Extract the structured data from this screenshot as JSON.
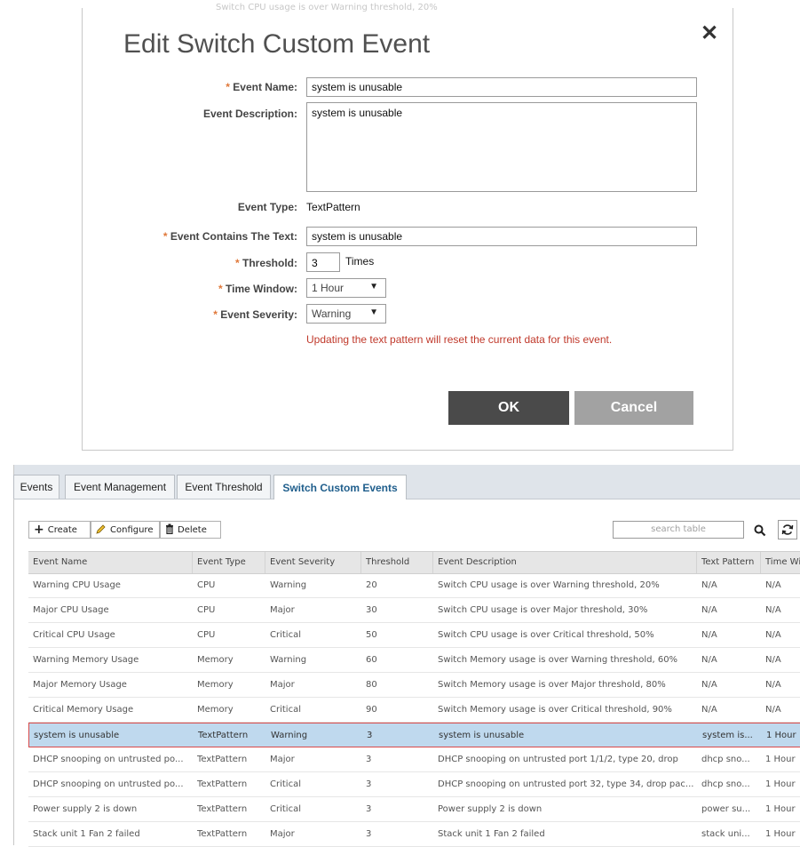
{
  "modal": {
    "bleed_text": "Switch CPU usage is over Warning threshold, 20%",
    "title": "Edit Switch Custom Event",
    "close_glyph": "✕",
    "required_mark": "*",
    "fields": {
      "event_name": {
        "label": "Event Name:",
        "value": "system is unusable",
        "required": true
      },
      "event_description": {
        "label": "Event Description:",
        "value": "system is unusable"
      },
      "event_type": {
        "label": "Event Type:",
        "value": "TextPattern"
      },
      "contains_text": {
        "label": "Event Contains The Text:",
        "value": "system is unusable",
        "required": true
      },
      "threshold": {
        "label": "Threshold:",
        "value": "3",
        "unit": "Times",
        "required": true
      },
      "time_window": {
        "label": "Time Window:",
        "value": "1 Hour",
        "required": true
      },
      "severity": {
        "label": "Event Severity:",
        "value": "Warning",
        "required": true
      }
    },
    "warning": "Updating the text pattern will reset the current data for this event.",
    "ok_label": "OK",
    "cancel_label": "Cancel"
  },
  "page": {
    "tabs": [
      {
        "label": "Events"
      },
      {
        "label": "Event Management"
      },
      {
        "label": "Event Threshold"
      },
      {
        "label": "Switch Custom Events"
      }
    ],
    "active_tab": "Switch Custom Events",
    "toolbar": {
      "create_label": "Create",
      "configure_label": "Configure",
      "delete_label": "Delete",
      "search_placeholder": "search table"
    },
    "table": {
      "columns": [
        "Event Name",
        "Event Type",
        "Event Severity",
        "Threshold",
        "Event Description",
        "Text Pattern",
        "Time Window"
      ],
      "rows": [
        [
          "Warning CPU Usage",
          "CPU",
          "Warning",
          "20",
          "Switch CPU usage is over Warning threshold, 20%",
          "N/A",
          "N/A"
        ],
        [
          "Major CPU Usage",
          "CPU",
          "Major",
          "30",
          "Switch CPU usage is over Major threshold, 30%",
          "N/A",
          "N/A"
        ],
        [
          "Critical CPU Usage",
          "CPU",
          "Critical",
          "50",
          "Switch CPU usage is over Critical threshold, 50%",
          "N/A",
          "N/A"
        ],
        [
          "Warning Memory Usage",
          "Memory",
          "Warning",
          "60",
          "Switch Memory usage is over Warning threshold, 60%",
          "N/A",
          "N/A"
        ],
        [
          "Major Memory Usage",
          "Memory",
          "Major",
          "80",
          "Switch Memory usage is over Major threshold, 80%",
          "N/A",
          "N/A"
        ],
        [
          "Critical Memory Usage",
          "Memory",
          "Critical",
          "90",
          "Switch Memory usage is over Critical threshold, 90%",
          "N/A",
          "N/A"
        ],
        [
          "system is unusable",
          "TextPattern",
          "Warning",
          "3",
          "system is unusable",
          "system is...",
          "1 Hour"
        ],
        [
          "DHCP snooping on untrusted po...",
          "TextPattern",
          "Major",
          "3",
          "DHCP snooping on untrusted port 1/1/2, type 20, drop",
          "dhcp sno...",
          "1 Hour"
        ],
        [
          "DHCP snooping on untrusted po...",
          "TextPattern",
          "Critical",
          "3",
          "DHCP snooping on untrusted port 32, type 34, drop pac...",
          "dhcp sno...",
          "1 Hour"
        ],
        [
          "Power supply 2 is down",
          "TextPattern",
          "Critical",
          "3",
          "Power supply 2 is down",
          "power su...",
          "1 Hour"
        ],
        [
          "Stack unit 1 Fan 2 failed",
          "TextPattern",
          "Major",
          "3",
          "Stack unit 1 Fan 2 failed",
          "stack uni...",
          "1 Hour"
        ]
      ],
      "selected_row": 6
    }
  }
}
